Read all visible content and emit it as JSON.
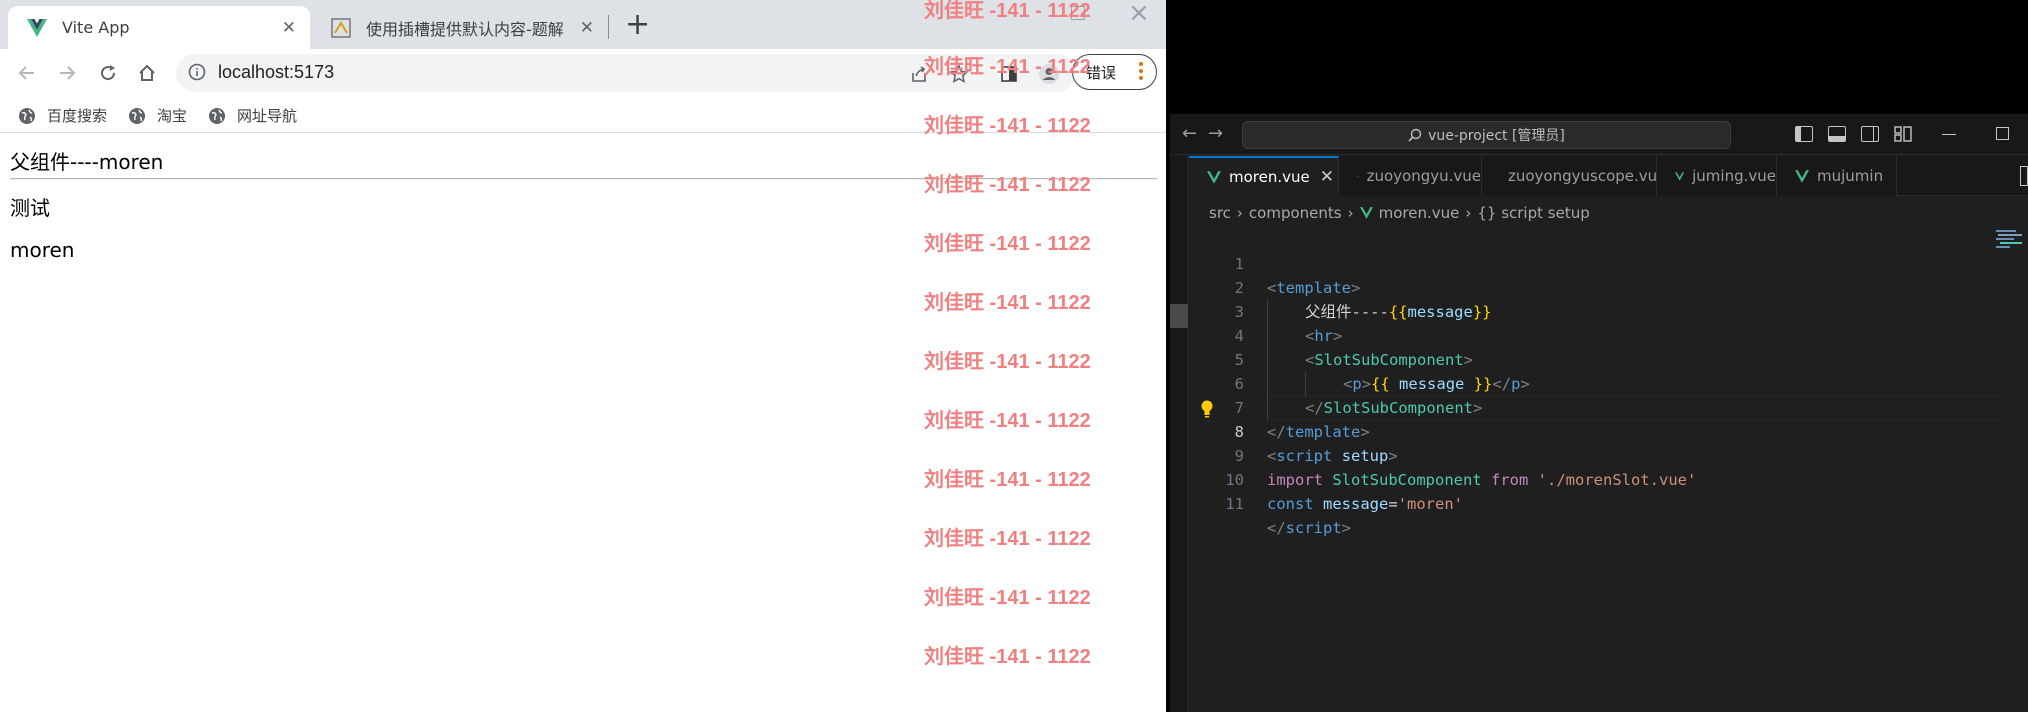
{
  "browser": {
    "tabs": [
      {
        "title": "Vite App",
        "active": true
      },
      {
        "title": "使用插槽提供默认内容-题解",
        "active": false
      }
    ],
    "new_tab": "+",
    "url": "localhost:5173",
    "error_button": "错误",
    "bookmarks": [
      "百度搜索",
      "淘宝",
      "网址导航"
    ],
    "page": {
      "parent_text": "父组件----moren",
      "line2": "测试",
      "line3": "moren"
    },
    "watermark_text": "刘佳旺 -141 - 1122"
  },
  "vscode": {
    "command_center": "vue-project [管理员]",
    "tabs": [
      {
        "label": "moren.vue",
        "active": true
      },
      {
        "label": "zuoyongyu.vue",
        "active": false
      },
      {
        "label": "zuoyongyuscope.vue",
        "active": false
      },
      {
        "label": "juming.vue",
        "active": false
      },
      {
        "label": "mujumin",
        "active": false
      }
    ],
    "breadcrumb": [
      "src",
      "components",
      "moren.vue",
      "{} script setup"
    ],
    "active_line": 8,
    "lines": [
      {
        "n": "1"
      },
      {
        "n": "2"
      },
      {
        "n": "3"
      },
      {
        "n": "4"
      },
      {
        "n": "5"
      },
      {
        "n": "6"
      },
      {
        "n": "7"
      },
      {
        "n": "8"
      },
      {
        "n": "9"
      },
      {
        "n": "10"
      },
      {
        "n": "11"
      }
    ],
    "code": {
      "template_tag": "template",
      "parent_label": "父组件----",
      "message_var": "message",
      "hr_tag": "hr",
      "component": "SlotSubComponent",
      "p_tag": "p",
      "script_tag": "script",
      "setup_attr": "setup",
      "import_kw": "import",
      "from_kw": "from",
      "import_path": "'./morenSlot.vue'",
      "const_kw": "const",
      "moren_str": "'moren'"
    }
  },
  "colors": {
    "watermark": "#f08080",
    "vue_green": "#41b883",
    "vscode_bg": "#1f1f1f",
    "tab_active_border": "#0078d4"
  }
}
